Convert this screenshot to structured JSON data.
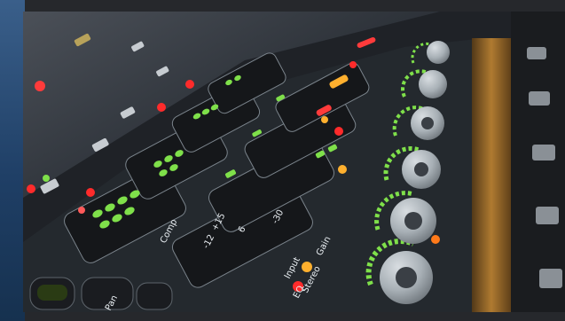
{
  "image": {
    "labels": {
      "comp": "Comp",
      "input": "Input",
      "stereo": "Stereo",
      "gain": "Gain",
      "eq": "EQ",
      "pan": "Pan",
      "scale_plus15": "+15",
      "scale_minus12": "-12",
      "scale_minus30": "-30",
      "scale_six": "6"
    },
    "colors": {
      "led_green": "#7fe04a",
      "led_red": "#ff2b2b",
      "led_amber": "#ffb02e",
      "led_orange": "#ff7a1a",
      "panel_dark": "#1d2024",
      "panel_mid": "#3a4047"
    }
  }
}
